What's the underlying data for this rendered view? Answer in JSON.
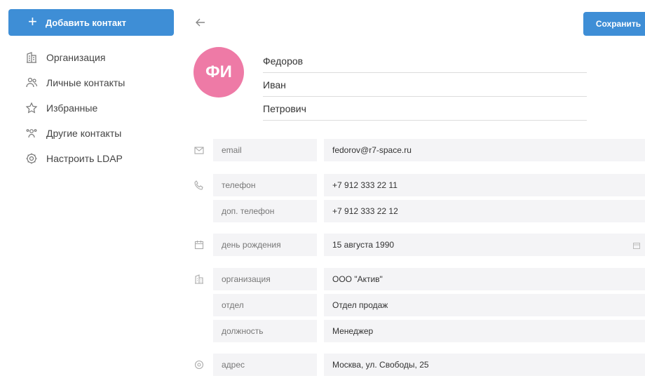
{
  "sidebar": {
    "add_button": {
      "icon": "plus-icon",
      "label": "Добавить контакт"
    },
    "items": [
      {
        "icon": "building-icon",
        "label": "Организация"
      },
      {
        "icon": "users-icon",
        "label": "Личные контакты"
      },
      {
        "icon": "star-icon",
        "label": "Избранные"
      },
      {
        "icon": "contacts-icon",
        "label": "Другие контакты"
      },
      {
        "icon": "gear-icon",
        "label": "Настроить LDAP"
      }
    ]
  },
  "toolbar": {
    "back_icon": "arrow-left-icon",
    "save_label": "Сохранить"
  },
  "contact": {
    "initials": "ФИ",
    "avatar_color": "#ee7aa6",
    "last_name": "Федоров",
    "first_name": "Иван",
    "middle_name": "Петрович"
  },
  "fields": {
    "email": {
      "label": "email",
      "value": "fedorov@r7-space.ru"
    },
    "phone": {
      "label": "телефон",
      "value": "+7 912 333 22 11"
    },
    "phone2": {
      "label": "доп. телефон",
      "value": "+7 912 333 22 12"
    },
    "birthday": {
      "label": "день рождения",
      "value": "15 августа 1990"
    },
    "organization": {
      "label": "организация",
      "value": "ООО \"Актив\""
    },
    "department": {
      "label": "отдел",
      "value": "Отдел продаж"
    },
    "position": {
      "label": "должность",
      "value": "Менеджер"
    },
    "address": {
      "label": "адрес",
      "value": "Москва, ул. Свободы, 25"
    }
  },
  "colors": {
    "accent": "#3e8ed6",
    "field_bg": "#f4f4f6"
  }
}
